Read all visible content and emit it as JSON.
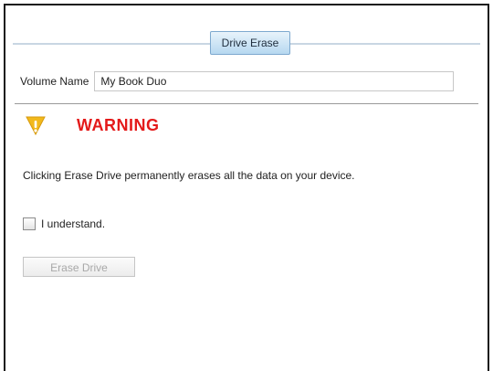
{
  "tab": {
    "label": "Drive Erase"
  },
  "volume": {
    "label": "Volume Name",
    "value": "My Book Duo"
  },
  "warning": {
    "title": "WARNING",
    "icon": "warning-icon",
    "message": "Clicking Erase Drive permanently erases all the data on your device."
  },
  "confirm": {
    "label": "I understand.",
    "checked": false
  },
  "actions": {
    "erase_label": "Erase Drive"
  },
  "colors": {
    "warning_text": "#e41a1a",
    "warning_icon": "#f2b91b",
    "tab_bg": "#cfe6f7"
  }
}
